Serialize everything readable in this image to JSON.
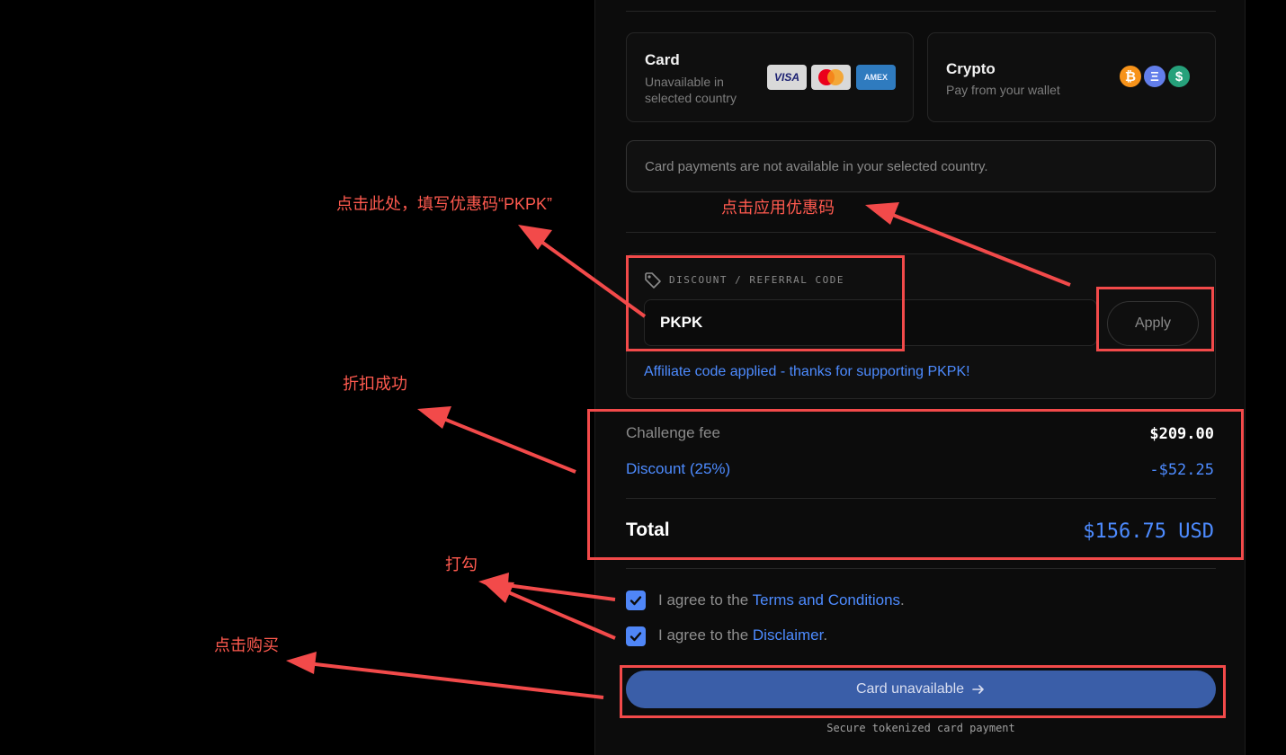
{
  "payment_methods": {
    "card": {
      "title": "Card",
      "subtitle": "Unavailable in selected country",
      "brands": [
        "VISA",
        "mastercard",
        "AMEX"
      ]
    },
    "crypto": {
      "title": "Crypto",
      "subtitle": "Pay from your wallet",
      "coins": [
        "bitcoin-icon",
        "ethereum-icon",
        "usdt-icon"
      ],
      "coin_glyphs": [
        "₿",
        "Ξ",
        "$"
      ]
    }
  },
  "notice": "Card payments are not available in your selected country.",
  "discount": {
    "label": "DISCOUNT / REFERRAL CODE",
    "value": "PKPK",
    "apply_label": "Apply",
    "applied_message": "Affiliate code applied - thanks for supporting PKPK!"
  },
  "summary": {
    "fee_label": "Challenge fee",
    "fee_value": "$209.00",
    "discount_label": "Discount (25%)",
    "discount_value": "-$52.25",
    "total_label": "Total",
    "total_value": "$156.75 USD"
  },
  "agreements": [
    {
      "prefix": "I agree to the ",
      "link": "Terms and Conditions",
      "suffix": ".",
      "checked": true
    },
    {
      "prefix": "I agree to the ",
      "link": "Disclaimer",
      "suffix": ".",
      "checked": true
    }
  ],
  "buy_button": "Card unavailable",
  "secure_note": "Secure tokenized card payment",
  "annotations": {
    "enter_code": "点击此处，填写优惠码“PKPK”",
    "apply_code": "点击应用优惠码",
    "discount_success": "折扣成功",
    "check": "打勾",
    "buy": "点击购买"
  },
  "colors": {
    "accent": "#4d8bff",
    "annotation": "#f24a4a",
    "button": "#3a5ea8"
  }
}
